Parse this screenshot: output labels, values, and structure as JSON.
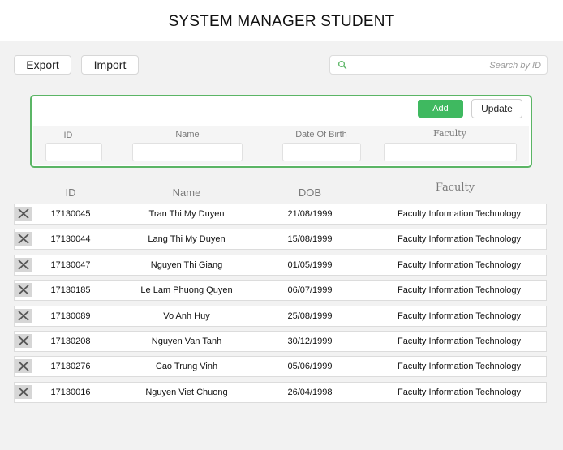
{
  "header": {
    "title": "SYSTEM MANAGER STUDENT"
  },
  "toolbar": {
    "export_label": "Export",
    "import_label": "Import",
    "search_placeholder": "Search by ID"
  },
  "form": {
    "add_label": "Add",
    "update_label": "Update",
    "fields": {
      "id_label": "ID",
      "name_label": "Name",
      "dob_label": "Date Of Birth",
      "faculty_label": "Faculty",
      "id_value": "",
      "name_value": "",
      "dob_value": "",
      "faculty_value": ""
    },
    "accent_color": "#5bb565",
    "add_color": "#3fb960"
  },
  "table": {
    "headers": {
      "id": "ID",
      "name": "Name",
      "dob": "DOB",
      "faculty": "Faculty"
    },
    "rows": [
      {
        "id": "17130045",
        "name": "Tran Thi My Duyen",
        "dob": "21/08/1999",
        "faculty": "Faculty Information Technology"
      },
      {
        "id": "17130044",
        "name": "Lang Thi My Duyen",
        "dob": "15/08/1999",
        "faculty": "Faculty Information Technology"
      },
      {
        "id": "17130047",
        "name": "Nguyen Thi Giang",
        "dob": "01/05/1999",
        "faculty": "Faculty Information Technology"
      },
      {
        "id": "17130185",
        "name": "Le Lam Phuong Quyen",
        "dob": "06/07/1999",
        "faculty": "Faculty Information Technology"
      },
      {
        "id": "17130089",
        "name": "Vo Anh Huy",
        "dob": "25/08/1999",
        "faculty": "Faculty Information Technology"
      },
      {
        "id": "17130208",
        "name": "Nguyen Van Tanh",
        "dob": "30/12/1999",
        "faculty": "Faculty Information Technology"
      },
      {
        "id": "17130276",
        "name": "Cao Trung Vinh",
        "dob": "05/06/1999",
        "faculty": "Faculty Information Technology"
      },
      {
        "id": "17130016",
        "name": "Nguyen Viet Chuong",
        "dob": "26/04/1998",
        "faculty": "Faculty Information Technology"
      }
    ]
  }
}
